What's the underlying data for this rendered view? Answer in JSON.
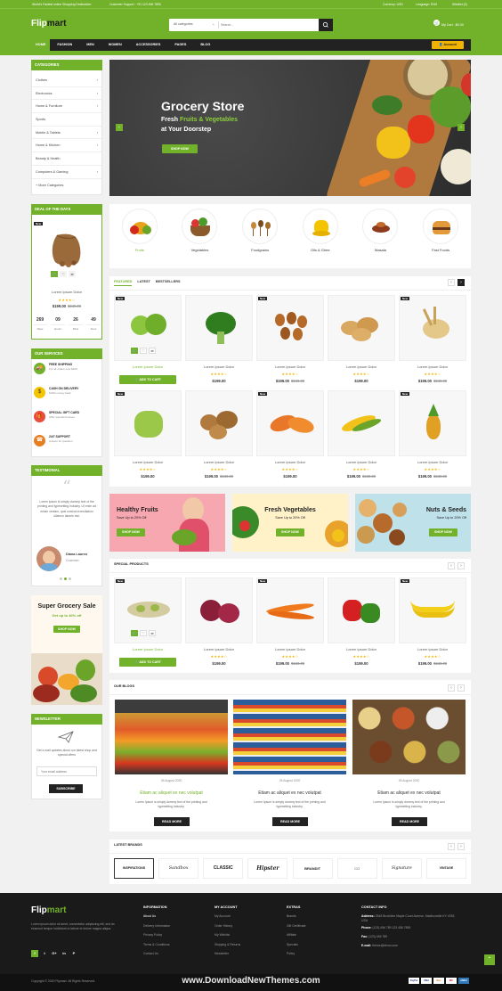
{
  "topbar": {
    "left1": "World's Fastest online Shopping Destination",
    "left2": "Customer Support : +91 123 456 7890",
    "currency": "Currency: USD",
    "language": "Language: ENG",
    "wishlist": "Wishlist (0)"
  },
  "header": {
    "logo_a": "Flip",
    "logo_b": "mart",
    "category_select": "All categories",
    "search_placeholder": "Search...",
    "cart": "My Cart - $0.00"
  },
  "nav": {
    "items": [
      "HOME",
      "FASHION",
      "MEN",
      "WOMEN",
      "ACCESSORIES",
      "PAGES",
      "BLOG"
    ],
    "account": "Account"
  },
  "sidebar": {
    "categories_title": "CATEGORIES",
    "categories": [
      "Clothes",
      "Electronics",
      "Home & Furniture",
      "Sports",
      "Mobile & Tablets",
      "Home & Kitchen",
      "Beauty & Health",
      "Computers & Gaming",
      "More Categories"
    ],
    "deal_title": "DEAL OF THE DAYS",
    "deal_badge": "New",
    "deal_name": "Lorem Ipsum Dolor",
    "deal_price": "$199.00",
    "deal_old": "$249.00",
    "deal_stars": "★★★★☆",
    "countdown": [
      {
        "v": "269",
        "l": "Days"
      },
      {
        "v": "09",
        "l": "Hours"
      },
      {
        "v": "26",
        "l": "Mins"
      },
      {
        "v": "49",
        "l": "Secs"
      }
    ],
    "services_title": "OUR SERVICES",
    "services": [
      {
        "t": "FREE SHIPPING",
        "d": "For all orders over $100"
      },
      {
        "t": "CASH ON DELIVERY",
        "d": "100% money back"
      },
      {
        "t": "SPECIAL GIFT CARD",
        "d": "Offer special bonuses"
      },
      {
        "t": "24/7 SUPPORT",
        "d": "Answer for question"
      }
    ],
    "testimonial_title": "TESTIMONIAL",
    "testimonial_text": "Lorem Ipsum is simply dummy text of the printing and typesetting industry. Ut enim ad minim veniam, quis nostrud exercitation ullamco laboris nisi.",
    "testimonial_name": "Diana Lauren",
    "testimonial_role": "Customer",
    "sale_title": "Super Grocery Sale",
    "sale_sub": "Get up to 40% off",
    "sale_btn": "SHOP NOW",
    "newsletter_title": "NEWSLETTER",
    "newsletter_text": "Get e-mail updates about our latest shop and special offers",
    "newsletter_placeholder": "Your email address",
    "newsletter_btn": "SUBSCRIBE"
  },
  "hero": {
    "title": "Grocery Store",
    "line1a": "Fresh ",
    "line1b": "Fruits & Vegetables",
    "line2": "at Your Doorstep",
    "btn": "SHOP NOW"
  },
  "cats": [
    "Fruits",
    "Vegetables",
    "Foodgrains",
    "Oils & Ghee",
    "Masala",
    "Fast Foods"
  ],
  "featured": {
    "tabs": [
      "FEATURED",
      "LATEST",
      "BESTSELLERS"
    ],
    "add_to_cart": "ADD TO CART",
    "row1": [
      {
        "name": "Lorem Ipsum Dolor",
        "price": "$199.00",
        "old": "",
        "new": true,
        "stars": "★★★★☆"
      },
      {
        "name": "Lorem Ipsum Dolor",
        "price": "$199.00",
        "old": "",
        "new": false,
        "stars": "★★★★☆"
      },
      {
        "name": "Lorem Ipsum Dolor",
        "price": "$199.00",
        "old": "$249.00",
        "new": true,
        "stars": "★★★★☆"
      },
      {
        "name": "Lorem Ipsum Dolor",
        "price": "$199.00",
        "old": "",
        "new": false,
        "stars": "★★★★☆"
      },
      {
        "name": "Lorem Ipsum Dolor",
        "price": "$199.00",
        "old": "$249.00",
        "new": true,
        "stars": "★★★★☆"
      }
    ],
    "row2": [
      {
        "name": "Lorem Ipsum Dolor",
        "price": "$199.00",
        "old": "",
        "new": true,
        "stars": "★★★★☆"
      },
      {
        "name": "Lorem Ipsum Dolor",
        "price": "$199.00",
        "old": "$249.00",
        "new": false,
        "stars": "★★★★☆"
      },
      {
        "name": "Lorem Ipsum Dolor",
        "price": "$199.00",
        "old": "",
        "new": true,
        "stars": "★★★★☆"
      },
      {
        "name": "Lorem Ipsum Dolor",
        "price": "$199.00",
        "old": "$249.00",
        "new": false,
        "stars": "★★★★☆"
      },
      {
        "name": "Lorem Ipsum Dolor",
        "price": "$199.00",
        "old": "$249.00",
        "new": true,
        "stars": "★★★★☆"
      }
    ]
  },
  "banners": [
    {
      "title": "Healthy Fruits",
      "sub": "Save Up to 20% Off",
      "btn": "SHOP NOW"
    },
    {
      "title": "Fresh Vegetables",
      "sub": "Save Up to 20% Off",
      "btn": "SHOP NOW"
    },
    {
      "title": "Nuts & Seeds",
      "sub": "Save Up to 20% Off",
      "btn": "SHOP NOW"
    }
  ],
  "special": {
    "title": "SPECIAL PRODUCTS",
    "add_to_cart": "ADD TO CART",
    "items": [
      {
        "name": "Lorem Ipsum Dolor",
        "price": "$199.00",
        "old": "",
        "new": true,
        "stars": "★★★★☆"
      },
      {
        "name": "Lorem Ipsum Dolor",
        "price": "$199.00",
        "old": "",
        "new": false,
        "stars": "★★★★☆"
      },
      {
        "name": "Lorem Ipsum Dolor",
        "price": "$199.00",
        "old": "$249.00",
        "new": true,
        "stars": "★★★★☆"
      },
      {
        "name": "Lorem Ipsum Dolor",
        "price": "$199.00",
        "old": "",
        "new": false,
        "stars": "★★★★☆"
      },
      {
        "name": "Lorem Ipsum Dolor",
        "price": "$199.00",
        "old": "$249.00",
        "new": true,
        "stars": "★★★★☆"
      }
    ]
  },
  "blogs": {
    "title": "OUR BLOGS",
    "items": [
      {
        "date": "05 August 2020",
        "title": "Etiam ac aliquet ex nec volutpat",
        "text": "Lorem Ipsum is simply dummy text of the printing and typesetting industry.",
        "btn": "READ MORE"
      },
      {
        "date": "05 August 2020",
        "title": "Etiam ac aliquet ex nec volutpat",
        "text": "Lorem Ipsum is simply dummy text of the printing and typesetting industry.",
        "btn": "READ MORE"
      },
      {
        "date": "05 August 2020",
        "title": "Etiam ac aliquet ex nec volutpat",
        "text": "Lorem Ipsum is simply dummy text of the printing and typesetting industry.",
        "btn": "READ MORE"
      }
    ]
  },
  "brands": {
    "title": "LATEST BRANDS",
    "items": [
      "INSPIRATIONS",
      "Sandbox",
      "CLASSIC",
      "Hipster",
      "BRANDIT",
      "CO",
      "Signature",
      "VINTAGE"
    ]
  },
  "footer": {
    "logo_a": "Flip",
    "logo_b": "mart",
    "about": "Lorem ipsum dolor sit amet, consectetur adipiscing elit, sed do eiusmod tempor incididunt ut labore et dolore magna aliqua.",
    "socials": [
      "f",
      "t",
      "G+",
      "in",
      "P"
    ],
    "cols": [
      {
        "title": "INFORMATION",
        "links": [
          "About Us",
          "Delivery Information",
          "Privacy Policy",
          "Terms & Conditions",
          "Contact Us"
        ]
      },
      {
        "title": "MY ACCOUNT",
        "links": [
          "My Account",
          "Order History",
          "My Wishlist",
          "Shipping & Returns",
          "Newsletter"
        ]
      },
      {
        "title": "EXTRAS",
        "links": [
          "Brands",
          "Gift Certificate",
          "Affiliate",
          "Specials",
          "Policy"
        ]
      }
    ],
    "contact_title": "CONTACT INFO",
    "address_label": "Address:",
    "address": "2548 Brookline Maple Court Avenue, Madisonville KY 4783, USA",
    "phone_label": "Phone:",
    "phone": "(123) 456 789 123 456 7890",
    "fax_label": "Fax:",
    "fax": "(123) 456 789",
    "email_label": "E-mail:",
    "email": "theme@demo.com",
    "copyright": "Copyright © 2020 Flipmart. All Rights Reserved.",
    "payments": [
      "PayPal",
      "VISA",
      "Disc",
      "MC",
      "AMEX"
    ]
  },
  "watermark": "www.DownloadNewThemes.com"
}
